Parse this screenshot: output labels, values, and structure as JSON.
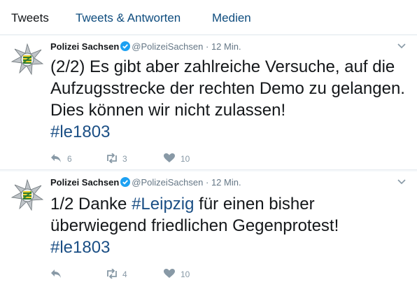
{
  "tabs": [
    {
      "label": "Tweets"
    },
    {
      "label": "Tweets & Antworten"
    },
    {
      "label": "Medien"
    }
  ],
  "tweets": [
    {
      "name": "Polizei Sachsen",
      "handle": "@PolizeiSachsen",
      "separator": "·",
      "time": "12 Min.",
      "text_plain": "(2/2) Es gibt aber zahlreiche Versuche, auf die Aufzugsstrecke der rechten Demo zu gelangen. Dies können wir nicht zulassen!",
      "hashtag": "#le1803",
      "reply_count": "6",
      "retweet_count": "3",
      "like_count": "10"
    },
    {
      "name": "Polizei Sachsen",
      "handle": "@PolizeiSachsen",
      "separator": "·",
      "time": "12 Min.",
      "text_before": "1/2 Danke ",
      "inline_hashtag": "#Leipzig",
      "text_after": " für einen bisher überwiegend friedlichen Gegenprotest!",
      "hashtag": "#le1803",
      "reply_count": "",
      "retweet_count": "4",
      "like_count": "10"
    }
  ],
  "icons": {
    "verified": "verified-badge-icon",
    "caret": "chevron-down-icon",
    "reply": "reply-icon",
    "retweet": "retweet-icon",
    "like": "heart-icon",
    "avatar": "police-star-logo"
  },
  "colors": {
    "hashtag": "#1b4f85",
    "verified": "#1da1f2",
    "muted": "#657786",
    "action": "#8899a6"
  }
}
